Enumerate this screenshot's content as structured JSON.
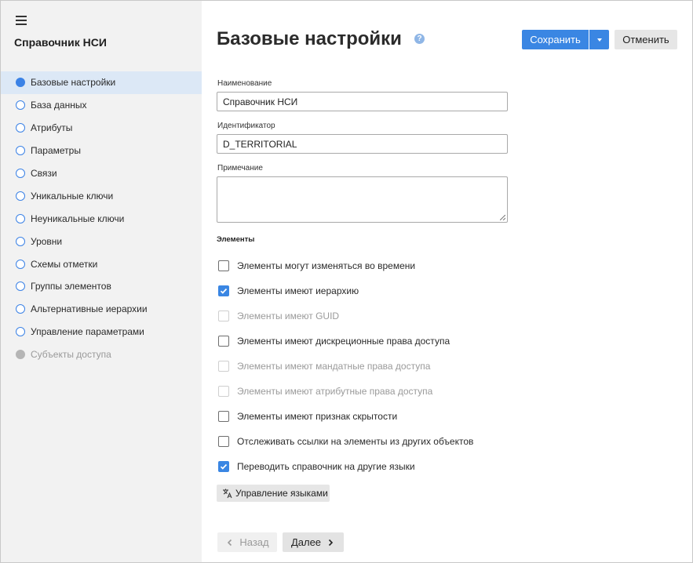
{
  "sidebar": {
    "title": "Справочник НСИ",
    "items": [
      {
        "label": "Базовые настройки",
        "state": "active"
      },
      {
        "label": "База данных",
        "state": "normal"
      },
      {
        "label": "Атрибуты",
        "state": "normal"
      },
      {
        "label": "Параметры",
        "state": "normal"
      },
      {
        "label": "Связи",
        "state": "normal"
      },
      {
        "label": "Уникальные ключи",
        "state": "normal"
      },
      {
        "label": "Неуникальные ключи",
        "state": "normal"
      },
      {
        "label": "Уровни",
        "state": "normal"
      },
      {
        "label": "Схемы отметки",
        "state": "normal"
      },
      {
        "label": "Группы элементов",
        "state": "normal"
      },
      {
        "label": "Альтернативные иерархии",
        "state": "normal"
      },
      {
        "label": "Управление параметрами",
        "state": "normal"
      },
      {
        "label": "Субъекты доступа",
        "state": "disabled"
      }
    ]
  },
  "header": {
    "title": "Базовые настройки",
    "help_icon": "help-icon",
    "help_glyph": "?",
    "save_label": "Сохранить",
    "cancel_label": "Отменить"
  },
  "form": {
    "name_label": "Наименование",
    "name_value": "Справочник НСИ",
    "id_label": "Идентификатор",
    "id_value": "D_TERRITORIAL",
    "note_label": "Примечание",
    "note_value": ""
  },
  "elements": {
    "section_label": "Элементы",
    "options": [
      {
        "label": "Элементы могут изменяться во времени",
        "checked": false,
        "disabled": false
      },
      {
        "label": "Элементы имеют иерархию",
        "checked": true,
        "disabled": false
      },
      {
        "label": "Элементы имеют GUID",
        "checked": false,
        "disabled": true
      },
      {
        "label": "Элементы имеют дискреционные права доступа",
        "checked": false,
        "disabled": false
      },
      {
        "label": "Элементы имеют мандатные права доступа",
        "checked": false,
        "disabled": true
      },
      {
        "label": "Элементы имеют атрибутные права доступа",
        "checked": false,
        "disabled": true
      },
      {
        "label": "Элементы имеют признак скрытости",
        "checked": false,
        "disabled": false
      },
      {
        "label": "Отслеживать ссылки на элементы из других объектов",
        "checked": false,
        "disabled": false
      },
      {
        "label": "Переводить справочник на другие языки",
        "checked": true,
        "disabled": false
      }
    ],
    "languages_button": "Управление языками"
  },
  "footer": {
    "back_label": "Назад",
    "next_label": "Далее"
  },
  "colors": {
    "accent": "#3a86e3",
    "active_nav_bg": "#dce8f6",
    "sidebar_bg": "#f2f2f2"
  }
}
